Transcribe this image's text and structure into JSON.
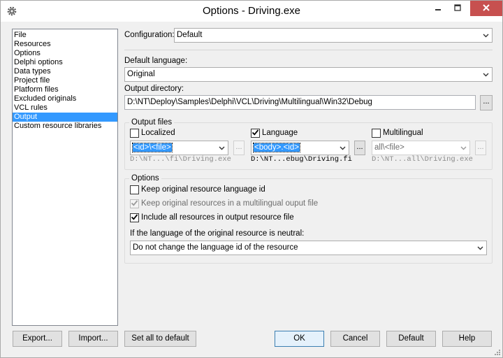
{
  "window": {
    "title": "Options - Driving.exe"
  },
  "sidebar": {
    "items": [
      {
        "label": "File"
      },
      {
        "label": "Resources"
      },
      {
        "label": "Options"
      },
      {
        "label": "Delphi options"
      },
      {
        "label": "Data types"
      },
      {
        "label": "Project file"
      },
      {
        "label": "Platform files"
      },
      {
        "label": "Excluded originals"
      },
      {
        "label": "VCL rules"
      },
      {
        "label": "Output",
        "selected": true
      },
      {
        "label": "Custom resource libraries"
      }
    ]
  },
  "main": {
    "configuration_label": "Configuration:",
    "configuration_value": "Default",
    "default_language_label": "Default language:",
    "default_language_value": "Original",
    "output_directory_label": "Output directory:",
    "output_directory_value": "D:\\NT\\Deploy\\Samples\\Delphi\\VCL\\Driving\\Multilingual\\Win32\\Debug",
    "browse_label": "...",
    "output_files": {
      "title": "Output files",
      "localized": {
        "label": "Localized",
        "checked": false,
        "pattern": "<id>\\<file>",
        "path": "D:\\NT...\\fi\\Driving.exe"
      },
      "language": {
        "label": "Language",
        "checked": true,
        "pattern": "<body>.<id>",
        "path": "D:\\NT...ebug\\Driving.fi"
      },
      "multilingual": {
        "label": "Multilingual",
        "checked": false,
        "pattern": "all\\<file>",
        "path": "D:\\NT...all\\Driving.exe"
      }
    },
    "options": {
      "title": "Options",
      "keep_language_id": {
        "label": "Keep original resource language id",
        "checked": false
      },
      "keep_in_multilingual": {
        "label": "Keep original resources in a multilingual ouput file",
        "checked": true,
        "disabled": true
      },
      "include_all": {
        "label": "Include all resources in output resource file",
        "checked": true
      },
      "neutral_label": "If the language of the original resource is neutral:",
      "neutral_value": "Do not change the language id of the resource"
    }
  },
  "footer": {
    "export_label": "Export...",
    "import_label": "Import...",
    "set_default_label": "Set all to default",
    "ok_label": "OK",
    "cancel_label": "Cancel",
    "default_label": "Default",
    "help_label": "Help"
  },
  "colors": {
    "selection": "#3399ff",
    "close_button": "#c7504f"
  }
}
